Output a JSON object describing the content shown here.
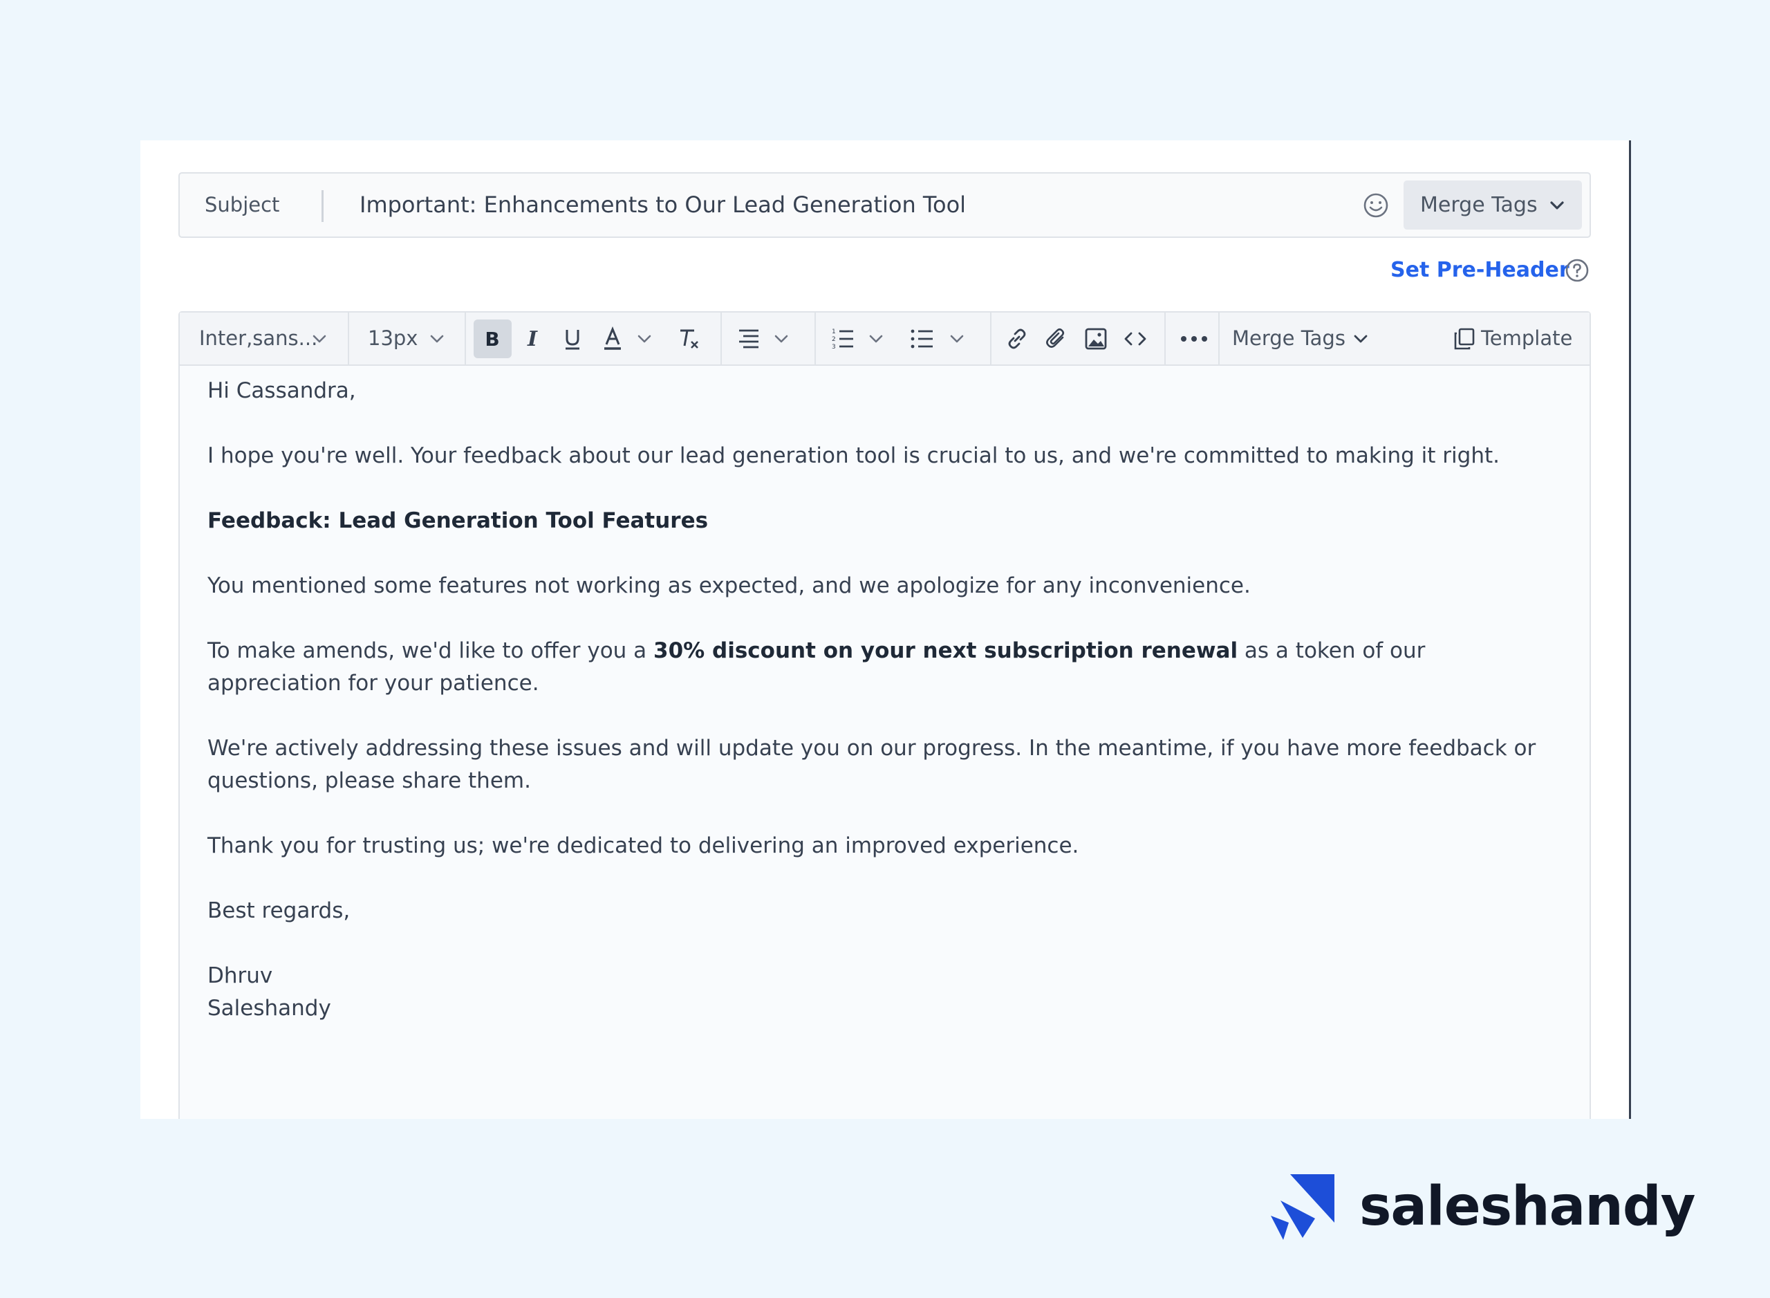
{
  "subject": {
    "label": "Subject",
    "value": "Important: Enhancements to Our Lead Generation Tool",
    "emoji_icon": "smiley-icon",
    "merge_tags_label": "Merge Tags"
  },
  "preheader": {
    "link_label": "Set Pre-Header",
    "help_icon": "question-circle-icon"
  },
  "toolbar": {
    "font_family": "Inter,sans...",
    "font_size": "13px",
    "merge_tags_label": "Merge Tags",
    "template_label": "Template",
    "bold_active": true
  },
  "email_body": {
    "greeting": "Hi Cassandra,",
    "intro": "I hope you're well. Your feedback about our lead generation tool is crucial to us, and we're committed to making it right.",
    "heading": "Feedback: Lead Generation Tool Features",
    "apology": "You mentioned some features not working as expected, and we apologize for any inconvenience.",
    "offer_prefix": "To make amends, we'd like to offer you a ",
    "offer_bold": "30% discount on your next subscription renewal",
    "offer_suffix": " as a token of our appreciation for your patience.",
    "progress": "We're actively addressing these issues and will update you on our progress. In the meantime, if you have more feedback or questions, please share them.",
    "thanks": "Thank you for trusting us; we're dedicated to delivering an improved experience.",
    "closing": "Best regards,",
    "sender_name": "Dhruv",
    "sender_company": "Saleshandy"
  },
  "brand": {
    "name": "saleshandy",
    "logo_color": "#1d4ed8"
  },
  "colors": {
    "accent": "#2563eb",
    "background": "#eef7fd"
  }
}
